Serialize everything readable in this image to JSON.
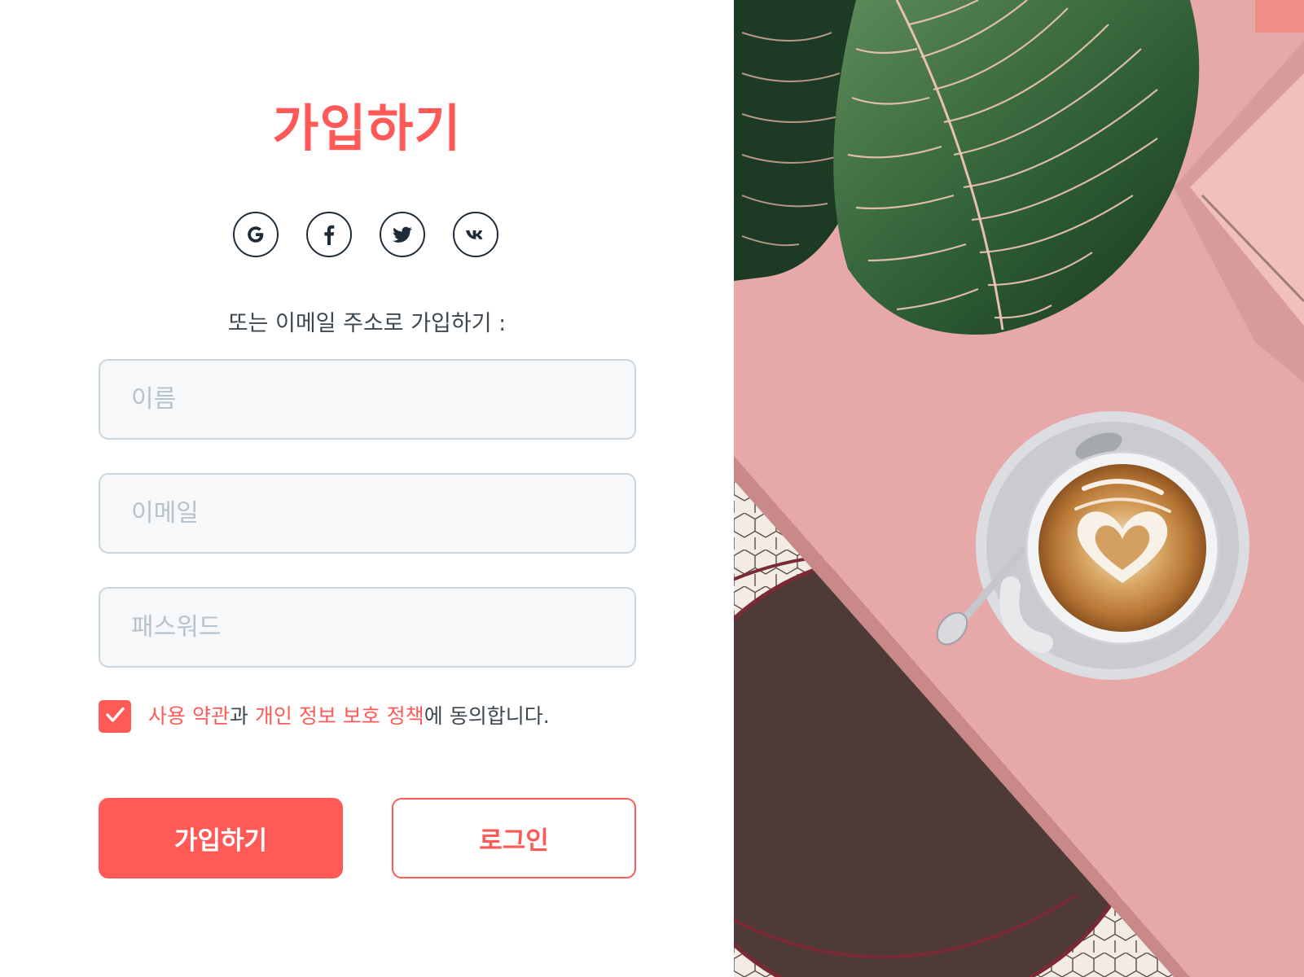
{
  "signup": {
    "title": "가입하기",
    "or_email_label": "또는 이메일 주소로 가입하기 :",
    "social": [
      "google-icon",
      "facebook-icon",
      "twitter-icon",
      "vk-icon"
    ],
    "fields": {
      "name_placeholder": "이름",
      "email_placeholder": "이메일",
      "password_placeholder": "패스워드"
    },
    "agree": {
      "checked": true,
      "terms_link": "사용 약관",
      "connector": "과 ",
      "privacy_link": "개인 정보 보호 정책",
      "suffix": "에 동의합니다."
    },
    "buttons": {
      "signup_label": "가입하기",
      "login_label": "로그인"
    }
  },
  "colors": {
    "accent": "#ff5a57",
    "text": "#3d4750",
    "icon_stroke": "#1e2c3a",
    "field_bg": "#f6f8fa",
    "field_border": "#c9d6df"
  }
}
